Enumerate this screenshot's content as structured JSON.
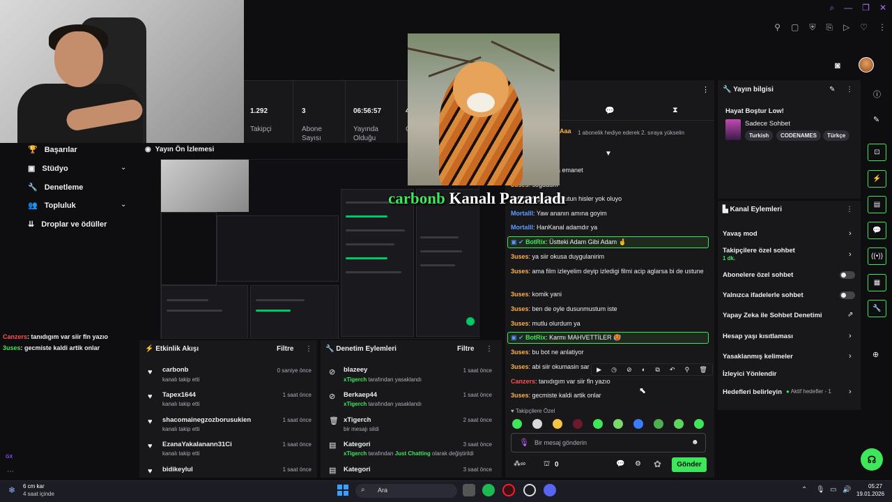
{
  "stats": [
    {
      "value": "1.292",
      "label": "Takipçi"
    },
    {
      "value": "3",
      "label": "Abone Sayısı"
    },
    {
      "value": "06:56:57",
      "label": "Yayında Olduğu"
    },
    {
      "value": "4",
      "label": "G"
    }
  ],
  "nav": {
    "basarilar": "Başarılar",
    "studyo": "Stüdyo",
    "denetleme": "Denetleme",
    "topluluk": "Topluluk",
    "droplar": "Droplar ve ödüller"
  },
  "preview": {
    "title": "Yayın Ön İzlemesi"
  },
  "overlay": {
    "brand": "carbonb",
    "text": "Kanalı Pazarladı"
  },
  "chat": {
    "gift_user": "Aaa",
    "gift_text": "1 abonelik hediye ederek 2. sıraya yükselin",
    "messages": [
      {
        "user": "",
        "text": "gen gidiom Allaha emanet"
      },
      {
        "user": "3uses",
        "text": "sogudum"
      },
      {
        "user": "",
        "text": "aglarken gorunce butun hisler yok oluyo"
      },
      {
        "user": "Mortalll",
        "text": "Yaw ananın amına goyim"
      },
      {
        "user": "Mortalll",
        "text": "HanKanal adamdır ya"
      },
      {
        "user": "BotRix",
        "text": "Üstteki Adam Gibi Adam 🤞"
      },
      {
        "user": "3uses",
        "text": "ya siir okusa duygulanirim"
      },
      {
        "user": "3uses",
        "text": "ama film izleyelim deyip izledigi filmi acip aglarsa bi de ustune"
      },
      {
        "user": "3uses",
        "text": "komik yani"
      },
      {
        "user": "3uses",
        "text": "ben de oyle dusunmustum iste"
      },
      {
        "user": "3uses",
        "text": "mutlu olurdum ya"
      },
      {
        "user": "BotRix",
        "text": "Karmı MAHVETTİLER 🥵"
      },
      {
        "user": "3uses",
        "text": "bu bot ne anlatiyor"
      },
      {
        "user": "3uses",
        "text": "abi siir okumasin sar"
      },
      {
        "user": "Canzers",
        "text": "tanıdıgım var siir fln yazıo"
      },
      {
        "user": "3uses",
        "text": "gecmiste kaldi artik onlar"
      }
    ],
    "emote_section": "Takipçilere Özel",
    "input_placeholder": "Bir mesaj gönderin",
    "points": "0",
    "send": "Gönder"
  },
  "overlay_chat": [
    {
      "user": "Canzers",
      "text": ": tanıdıgım var siir fln yazıo"
    },
    {
      "user": "3uses",
      "text": ": gecmiste kaldi artik onlar"
    }
  ],
  "yayin": {
    "title": "Yayın bilgisi",
    "stream_title": "Hayat Boştur Low!",
    "category": "Sadece Sohbet",
    "tags": [
      "Turkish",
      "CODENAMES",
      "Türkçe"
    ]
  },
  "kanal": {
    "title": "Kanal Eylemleri",
    "yavas": "Yavaş mod",
    "takipci": "Takipçilere özel sohbet",
    "takipci_sub": "1 dk.",
    "abone": "Abonelere özel sohbet",
    "ifade": "Yalnızca ifadelerle sohbet",
    "yapay": "Yapay Zeka ile Sohbet Denetimi",
    "hesap": "Hesap yaşı kısıtlaması",
    "yasak": "Yasaklanmış kelimeler",
    "izleyici": "İzleyici Yönlendir",
    "hedef": "Hedefleri belirleyin",
    "hedef_sub": "Aktif hedefler - 1"
  },
  "feed": {
    "title": "Etkinlik Akışı",
    "filter": "Filtre",
    "items": [
      {
        "name": "carbonb",
        "sub": "kanalı takip etti",
        "time": "0 saniye önce"
      },
      {
        "name": "Tapex1644",
        "sub": "kanalı takip etti",
        "time": "1 saat önce"
      },
      {
        "name": "shacomainegzozborusukien",
        "sub": "kanalı takip etti",
        "time": "1 saat önce"
      },
      {
        "name": "EzanaYakalanann31Ci",
        "sub": "kanalı takip etti",
        "time": "1 saat önce"
      },
      {
        "name": "bidikeylul",
        "sub": "",
        "time": "1 saat önce"
      }
    ]
  },
  "mod": {
    "title": "Denetim Eylemleri",
    "filter": "Filtre",
    "items": [
      {
        "name": "blazeey",
        "actor": "xTigerch",
        "sub": "tarafından yasaklandı",
        "time": "1 saat önce"
      },
      {
        "name": "Berkaep44",
        "actor": "xTigerch",
        "sub": "tarafından yasaklandı",
        "time": "1 saat önce"
      },
      {
        "name": "xTigerch",
        "actor": "",
        "sub": "bir mesajı sildi",
        "time": "2 saat önce"
      },
      {
        "name": "Kategori",
        "actor": "xTigerch",
        "sub": "tarafından",
        "extra": "Just Chatting",
        "sub2": "olarak değiştirildi",
        "time": "3 saat önce"
      },
      {
        "name": "Kategori",
        "actor": "",
        "sub": "",
        "time": "3 saat önce"
      }
    ]
  },
  "taskbar": {
    "weather": "6 cm kar",
    "weather_sub": "4 saat içinde",
    "search": "Ara",
    "time": "05:27",
    "date": "19.01.2026"
  },
  "colors": {
    "accent": "#3ee65a",
    "bg": "#0e0e10",
    "panel": "#18181b",
    "purple": "#9147ff"
  }
}
